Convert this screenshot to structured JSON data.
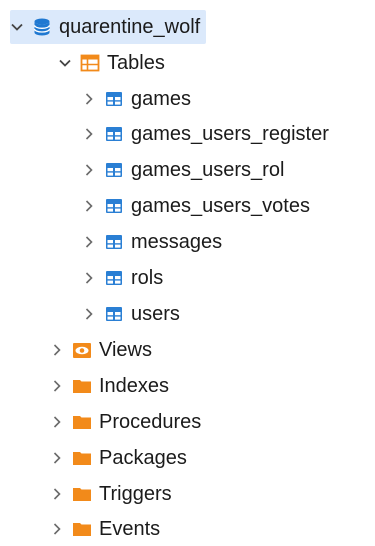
{
  "tree": {
    "root": {
      "label": "quarentine_wolf",
      "icon": "database-icon",
      "expanded": true,
      "selected": true
    },
    "tables_folder": {
      "label": "Tables",
      "icon": "table-folder-icon",
      "expanded": true
    },
    "tables": [
      {
        "label": "games",
        "icon": "table-icon"
      },
      {
        "label": "games_users_register",
        "icon": "table-icon"
      },
      {
        "label": "games_users_rol",
        "icon": "table-icon"
      },
      {
        "label": "games_users_votes",
        "icon": "table-icon"
      },
      {
        "label": "messages",
        "icon": "table-icon"
      },
      {
        "label": "rols",
        "icon": "table-icon"
      },
      {
        "label": "users",
        "icon": "table-icon"
      }
    ],
    "folders": [
      {
        "label": "Views",
        "icon": "eye-folder-icon"
      },
      {
        "label": "Indexes",
        "icon": "folder-icon"
      },
      {
        "label": "Procedures",
        "icon": "folder-icon"
      },
      {
        "label": "Packages",
        "icon": "folder-icon"
      },
      {
        "label": "Triggers",
        "icon": "folder-icon"
      },
      {
        "label": "Events",
        "icon": "folder-icon"
      }
    ]
  },
  "colors": {
    "database": "#1f78d1",
    "table": "#2a7fd4",
    "folder": "#f28a1a",
    "selection": "#dbe9fb",
    "chevron": "#555555"
  }
}
